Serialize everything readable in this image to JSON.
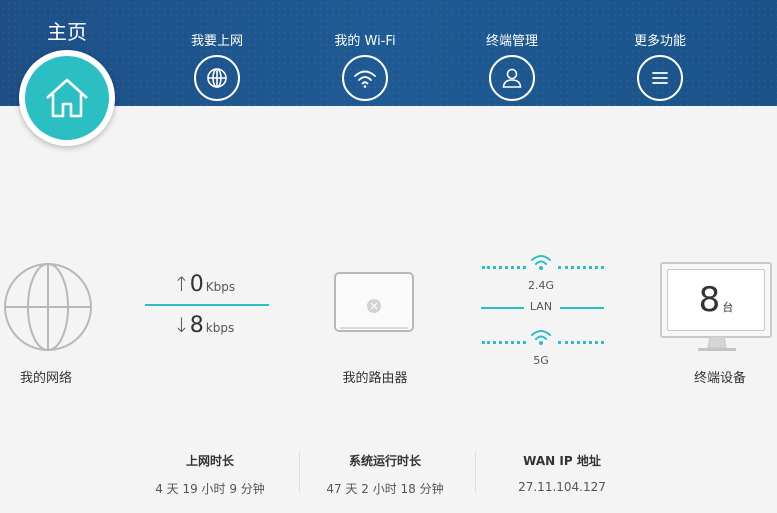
{
  "header": {
    "home_label": "主页",
    "nav": [
      {
        "label": "我要上网",
        "icon": "globe-icon"
      },
      {
        "label": "我的 Wi-Fi",
        "icon": "wifi-icon"
      },
      {
        "label": "终端管理",
        "icon": "user-icon"
      },
      {
        "label": "更多功能",
        "icon": "menu-icon"
      }
    ]
  },
  "network": {
    "label": "我的网络",
    "upload": {
      "value": "0",
      "unit": "Kbps"
    },
    "download": {
      "value": "8",
      "unit": "kbps"
    }
  },
  "router": {
    "label": "我的路由器",
    "band_24": "2.4G",
    "lan": "LAN",
    "band_5": "5G"
  },
  "devices": {
    "label": "终端设备",
    "count": "8",
    "unit": "台"
  },
  "info": {
    "online_time": {
      "title": "上网时长",
      "value": "4 天 19 小时 9 分钟"
    },
    "uptime": {
      "title": "系统运行时长",
      "value": "47 天 2 小时 18 分钟"
    },
    "wan_ip": {
      "title": "WAN IP 地址",
      "value": "27.11.104.127"
    }
  },
  "colors": {
    "header_blue": "#1f5a94",
    "accent_teal": "#2bbfc4",
    "background": "#f4f4f4"
  }
}
